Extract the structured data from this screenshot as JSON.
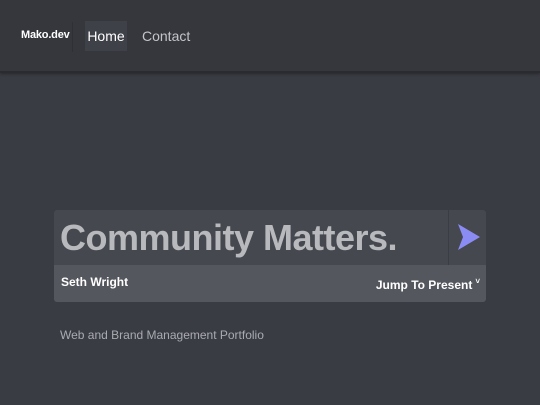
{
  "nav": {
    "brand": "Mako.dev",
    "home_label": "Home",
    "contact_label": "Contact"
  },
  "hero": {
    "title": "Community Matters.",
    "send_icon": "send-arrow-icon",
    "author": "Seth Wright",
    "jump_label": "Jump To Present",
    "jump_caret": "˅"
  },
  "subtitle": "Web and Brand Management Portfolio",
  "colors": {
    "background": "#3a3c43",
    "navbar": "#35373d",
    "card_top": "#464850",
    "card_bottom": "#55575f",
    "accent": "#8a8cf4"
  }
}
